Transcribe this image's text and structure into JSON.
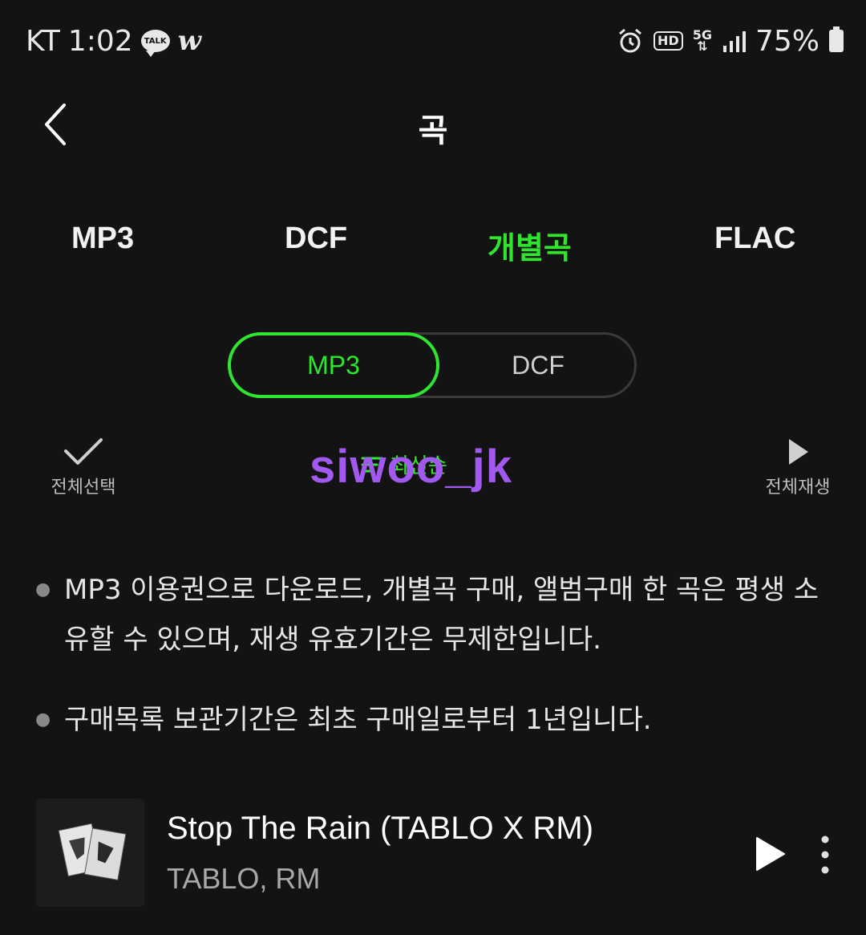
{
  "status_bar": {
    "carrier": "KT",
    "time": "1:02",
    "talk_icon_label": "TALK",
    "w_icon_label": "w",
    "hd_label": "HD",
    "network": "5G",
    "battery": "75%"
  },
  "header": {
    "title": "곡",
    "back_icon": "chevron-left-icon"
  },
  "tabs": [
    {
      "label": "MP3",
      "active": false
    },
    {
      "label": "DCF",
      "active": false
    },
    {
      "label": "개별곡",
      "active": true
    },
    {
      "label": "FLAC",
      "active": false
    }
  ],
  "format_toggle": {
    "options": [
      "MP3",
      "DCF"
    ],
    "selected": "MP3"
  },
  "actions": {
    "select_all": "전체선택",
    "sort": "최신순",
    "play_all": "전체재생"
  },
  "watermark": "siwoo_jk",
  "notices": [
    "MP3 이용권으로 다운로드, 개별곡 구매, 앨범구매 한 곡은 평생 소유할 수 있으며, 재생 유효기간은 무제한입니다.",
    "구매목록 보관기간은 최초 구매일로부터 1년입니다."
  ],
  "tracks": [
    {
      "title": "Stop The Rain (TABLO X RM)",
      "artist": "TABLO, RM"
    }
  ],
  "colors": {
    "background": "#131313",
    "accent": "#2ee62e",
    "watermark": "#a259f0"
  }
}
